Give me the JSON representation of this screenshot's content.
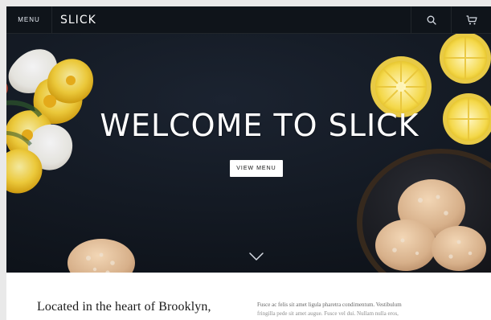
{
  "header": {
    "menu_label": "MENU",
    "brand": "SLICK",
    "search_icon": "search-icon",
    "cart_icon": "cart-icon"
  },
  "hero": {
    "title": "WELCOME TO SLICK",
    "cta_label": "VIEW MENU",
    "scroll_icon": "chevron-down-icon"
  },
  "content": {
    "headline": "Located in the heart of Brooklyn,",
    "body_line_1": "Fusce ac felis sit amet ligula pharetra condimentum. Vestibulum",
    "body_line_2": "fringilla pede sit amet augue. Fusce vel dui. Nullam nulla eros,"
  }
}
